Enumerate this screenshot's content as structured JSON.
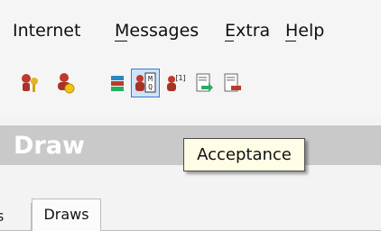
{
  "menu": {
    "items": [
      {
        "label": "Internet"
      },
      {
        "label": "Messages"
      },
      {
        "label": "Extra"
      },
      {
        "label": "Help"
      }
    ]
  },
  "toolbar": {
    "buttons": [
      {
        "icon": "users-key-icon"
      },
      {
        "icon": "user-settings-icon"
      },
      {
        "icon": "stack-icon"
      },
      {
        "icon": "user-mq-icon",
        "active": true
      },
      {
        "icon": "user-notice-icon"
      },
      {
        "icon": "document-arrow-icon"
      },
      {
        "icon": "document-remove-icon"
      }
    ]
  },
  "section": {
    "title": "Draw"
  },
  "tooltip": {
    "text": "Acceptance"
  },
  "tabs": {
    "partial_label": "s",
    "active_label": "Draws"
  },
  "colors": {
    "accent": "#3a7bd5",
    "band": "#c9c9c9",
    "tooltip_bg": "#fffde6"
  }
}
